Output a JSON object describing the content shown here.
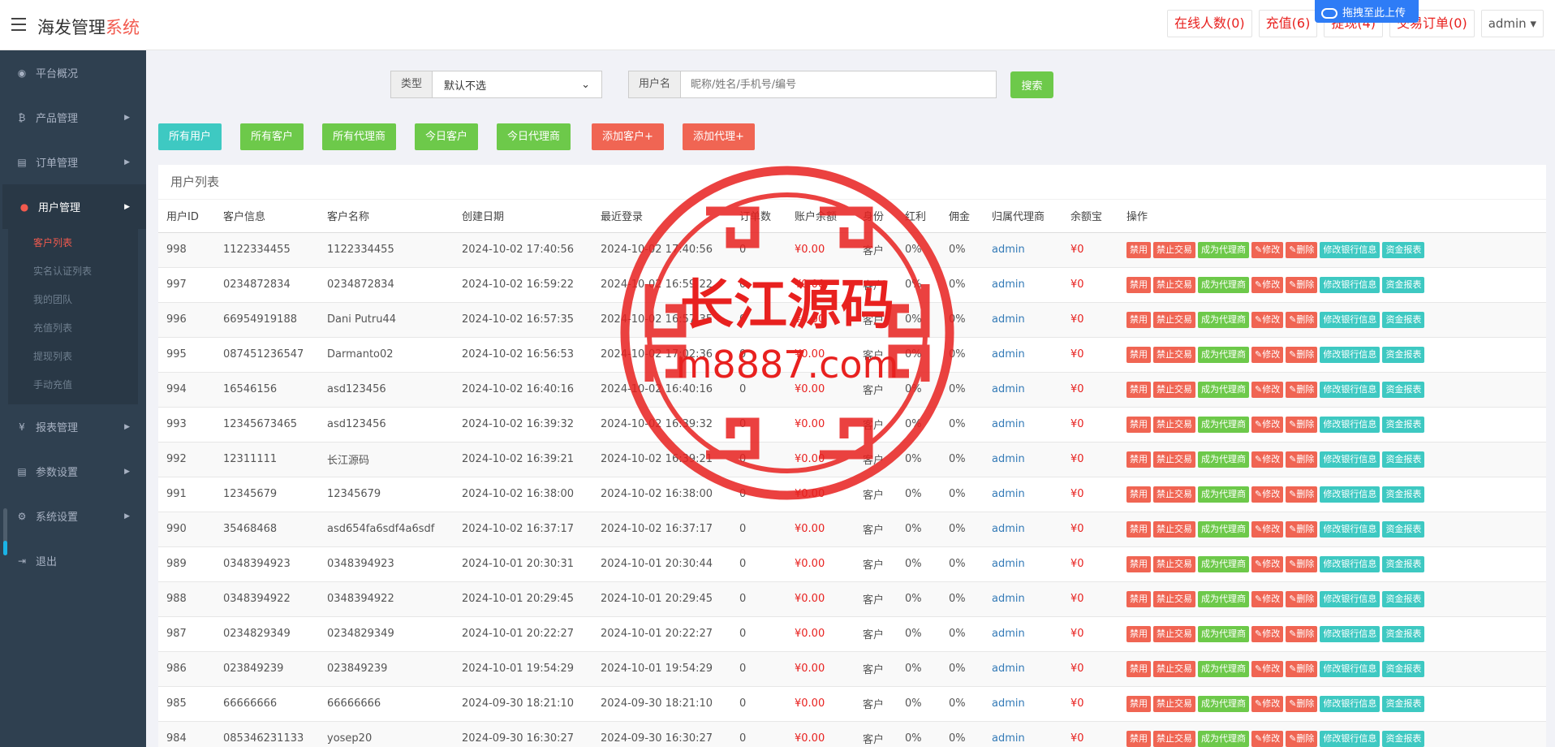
{
  "header": {
    "brand_main": "海发管理",
    "brand_accent": "系统",
    "buttons": [
      "在线人数(0)",
      "充值(6)",
      "提现(4)",
      "交易订单(0)"
    ],
    "admin_label": "admin",
    "upload_badge": "拖拽至此上传"
  },
  "sidebar": {
    "items": [
      {
        "label": "平台概况",
        "icon": "dashboard-icon",
        "glyph": "◉"
      },
      {
        "label": "产品管理",
        "icon": "bitcoin-icon",
        "glyph": "₿"
      },
      {
        "label": "订单管理",
        "icon": "copy-icon",
        "glyph": "▤"
      },
      {
        "label": "用户管理",
        "icon": "user-icon",
        "glyph": "●"
      },
      {
        "label": "报表管理",
        "icon": "yen-icon",
        "glyph": "¥"
      },
      {
        "label": "参数设置",
        "icon": "copy-icon",
        "glyph": "▤"
      },
      {
        "label": "系统设置",
        "icon": "cogs-icon",
        "glyph": "⚙"
      },
      {
        "label": "退出",
        "icon": "sign-out-icon",
        "glyph": "⇥"
      }
    ],
    "sub_items": [
      "客户列表",
      "实名认证列表",
      "我的团队",
      "充值列表",
      "提现列表",
      "手动充值"
    ]
  },
  "filter": {
    "type_label": "类型",
    "type_value": "默认不选",
    "username_label": "用户名",
    "username_placeholder": "昵称/姓名/手机号/编号",
    "search_label": "搜索"
  },
  "quick_buttons": [
    "所有用户",
    "所有客户",
    "所有代理商",
    "今日客户",
    "今日代理商",
    "添加客户+",
    "添加代理+"
  ],
  "panel_title": "用户列表",
  "columns": [
    "用户ID",
    "客户信息",
    "客户名称",
    "创建日期",
    "最近登录",
    "订单数",
    "账户余额",
    "身份",
    "红利",
    "佣金",
    "归属代理商",
    "余额宝",
    "操作"
  ],
  "actions": [
    "禁用",
    "禁止交易",
    "成为代理商",
    "✎修改",
    "✎删除",
    "修改银行信息",
    "资金报表"
  ],
  "rows": [
    [
      "998",
      "1122334455",
      "1122334455",
      "2024-10-02 17:40:56",
      "2024-10-02 17:40:56",
      "0",
      "¥0.00",
      "客户",
      "0%",
      "0%",
      "admin",
      "¥0"
    ],
    [
      "997",
      "0234872834",
      "0234872834",
      "2024-10-02 16:59:22",
      "2024-10-02 16:59:22",
      "0",
      "¥0.00",
      "客户",
      "0%",
      "0%",
      "admin",
      "¥0"
    ],
    [
      "996",
      "66954919188",
      "Dani Putru44",
      "2024-10-02 16:57:35",
      "2024-10-02 16:57:35",
      "0",
      "¥0.00",
      "客户",
      "0%",
      "0%",
      "admin",
      "¥0"
    ],
    [
      "995",
      "087451236547",
      "Darmanto02",
      "2024-10-02 16:56:53",
      "2024-10-02 17:02:36",
      "0",
      "¥0.00",
      "客户",
      "0%",
      "0%",
      "admin",
      "¥0"
    ],
    [
      "994",
      "16546156",
      "asd123456",
      "2024-10-02 16:40:16",
      "2024-10-02 16:40:16",
      "0",
      "¥0.00",
      "客户",
      "0%",
      "0%",
      "admin",
      "¥0"
    ],
    [
      "993",
      "12345673465",
      "asd123456",
      "2024-10-02 16:39:32",
      "2024-10-02 16:39:32",
      "0",
      "¥0.00",
      "客户",
      "0%",
      "0%",
      "admin",
      "¥0"
    ],
    [
      "992",
      "12311111",
      "长江源码",
      "2024-10-02 16:39:21",
      "2024-10-02 16:39:21",
      "0",
      "¥0.00",
      "客户",
      "0%",
      "0%",
      "admin",
      "¥0"
    ],
    [
      "991",
      "12345679",
      "12345679",
      "2024-10-02 16:38:00",
      "2024-10-02 16:38:00",
      "0",
      "¥0.00",
      "客户",
      "0%",
      "0%",
      "admin",
      "¥0"
    ],
    [
      "990",
      "35468468",
      "asd654fa6sdf4a6sdf",
      "2024-10-02 16:37:17",
      "2024-10-02 16:37:17",
      "0",
      "¥0.00",
      "客户",
      "0%",
      "0%",
      "admin",
      "¥0"
    ],
    [
      "989",
      "0348394923",
      "0348394923",
      "2024-10-01 20:30:31",
      "2024-10-01 20:30:44",
      "0",
      "¥0.00",
      "客户",
      "0%",
      "0%",
      "admin",
      "¥0"
    ],
    [
      "988",
      "0348394922",
      "0348394922",
      "2024-10-01 20:29:45",
      "2024-10-01 20:29:45",
      "0",
      "¥0.00",
      "客户",
      "0%",
      "0%",
      "admin",
      "¥0"
    ],
    [
      "987",
      "0234829349",
      "0234829349",
      "2024-10-01 20:22:27",
      "2024-10-01 20:22:27",
      "0",
      "¥0.00",
      "客户",
      "0%",
      "0%",
      "admin",
      "¥0"
    ],
    [
      "986",
      "023849239",
      "023849239",
      "2024-10-01 19:54:29",
      "2024-10-01 19:54:29",
      "0",
      "¥0.00",
      "客户",
      "0%",
      "0%",
      "admin",
      "¥0"
    ],
    [
      "985",
      "66666666",
      "66666666",
      "2024-09-30 18:21:10",
      "2024-09-30 18:21:10",
      "0",
      "¥0.00",
      "客户",
      "0%",
      "0%",
      "admin",
      "¥0"
    ],
    [
      "984",
      "085346231133",
      "yosep20",
      "2024-09-30 16:30:27",
      "2024-09-30 16:30:27",
      "0",
      "¥0.00",
      "客户",
      "0%",
      "0%",
      "admin",
      "¥0"
    ]
  ],
  "watermark": {
    "line1": "长江源码",
    "line2": "m8887.com",
    "color": "#e8211f"
  }
}
